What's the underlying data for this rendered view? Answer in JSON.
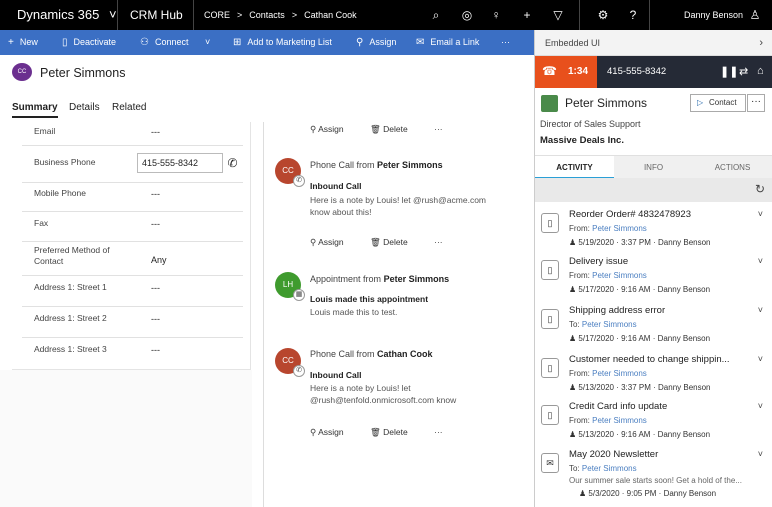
{
  "topbar": {
    "app_name": "Dynamics 365",
    "app_chevron": "˅",
    "hub_name": "CRM Hub",
    "breadcrumb": [
      "CORE",
      ">",
      "Contacts",
      ">",
      "Cathan Cook"
    ],
    "icons": [
      "search-icon",
      "target-icon",
      "lightbulb-icon",
      "plus-icon",
      "filter-icon",
      "gear-icon",
      "help-icon",
      "user-icon"
    ],
    "user_name": "Danny Benson"
  },
  "commandbar": {
    "new": "New",
    "deactivate": "Deactivate",
    "connect": "Connect",
    "add_marketing": "Add to Marketing List",
    "assign": "Assign",
    "email_link": "Email a Link",
    "more": "···"
  },
  "record": {
    "avatar_initials": "CC",
    "name": "Peter Simmons",
    "tabs": [
      "Summary",
      "Details",
      "Related"
    ]
  },
  "form": {
    "fields": [
      {
        "label": "Email",
        "value": "---"
      },
      {
        "label": "Business Phone",
        "value": "415-555-8342"
      },
      {
        "label": "Mobile Phone",
        "value": "---"
      },
      {
        "label": "Fax",
        "value": "---"
      },
      {
        "label": "Preferred Method of Contact",
        "value": "Any"
      },
      {
        "label": "Address 1: Street 1",
        "value": "---"
      },
      {
        "label": "Address 1: Street 2",
        "value": "---"
      },
      {
        "label": "Address 1: Street 3",
        "value": "---"
      }
    ]
  },
  "timeline": {
    "top_actions": {
      "assign": "Assign",
      "delete": "Delete",
      "more": "···"
    },
    "items": [
      {
        "initials": "CC",
        "color": "#b8462e",
        "title_prefix": "Phone Call from",
        "title_name": "Peter Simmons",
        "subject": "Inbound Call",
        "body": "Here is a note by Louis! let @rush@acme.com know about this!",
        "assign": "Assign",
        "delete": "Delete",
        "more": "···"
      },
      {
        "initials": "LH",
        "color": "#3f9b2e",
        "title_prefix": "Appointment from",
        "title_name": "Peter Simmons",
        "subject": "Louis made this appointment",
        "body": "Louis made this to test."
      },
      {
        "initials": "CC",
        "color": "#b8462e",
        "title_prefix": "Phone Call from",
        "title_name": "Cathan Cook",
        "subject": "Inbound Call",
        "body": "Here is a note by Louis! let @rush@tenfold.onmicrosoft.com know",
        "assign": "Assign",
        "delete": "Delete",
        "more": "···"
      }
    ]
  },
  "embedded": {
    "header": "Embedded UI",
    "call": {
      "timer": "1:34",
      "number": "415-555-8342",
      "accent": "#e8501c"
    },
    "contact": {
      "name": "Peter Simmons",
      "button": "Contact",
      "more": "···",
      "title": "Director of Sales Support",
      "company": "Massive Deals Inc."
    },
    "tabs": [
      "ACTIVITY",
      "INFO",
      "ACTIONS"
    ],
    "activities": [
      {
        "title": "Reorder Order# 4832478923",
        "dir": "From:",
        "who": "Peter Simmons",
        "date": "5/19/2020",
        "time": "3:37 PM",
        "owner": "Danny Benson",
        "icon": "phone-outgoing-icon"
      },
      {
        "title": "Delivery issue",
        "dir": "From:",
        "who": "Peter Simmons",
        "date": "5/17/2020",
        "time": "9:16 AM",
        "owner": "Danny Benson",
        "icon": "phone-outgoing-icon"
      },
      {
        "title": "Shipping address error",
        "dir": "To:",
        "who": "Peter Simmons",
        "date": "5/17/2020",
        "time": "9:16 AM",
        "owner": "Danny Benson",
        "icon": "phone-outgoing-icon"
      },
      {
        "title": "Customer needed to change shippin...",
        "dir": "From:",
        "who": "Peter Simmons",
        "date": "5/13/2020",
        "time": "3:37 PM",
        "owner": "Danny Benson",
        "icon": "phone-outgoing-icon"
      },
      {
        "title": "Credit Card info update",
        "dir": "From:",
        "who": "Peter Simmons",
        "date": "5/13/2020",
        "time": "9:16 AM",
        "owner": "Danny Benson",
        "icon": "phone-outgoing-icon"
      },
      {
        "title": "May 2020 Newsletter",
        "dir": "To:",
        "who": "Peter Simmons",
        "snippet": "Our summer sale starts soon! Get a hold of the...",
        "date": "5/3/2020",
        "time": "9:05 PM",
        "owner": "Danny Benson",
        "icon": "email-icon"
      }
    ]
  }
}
